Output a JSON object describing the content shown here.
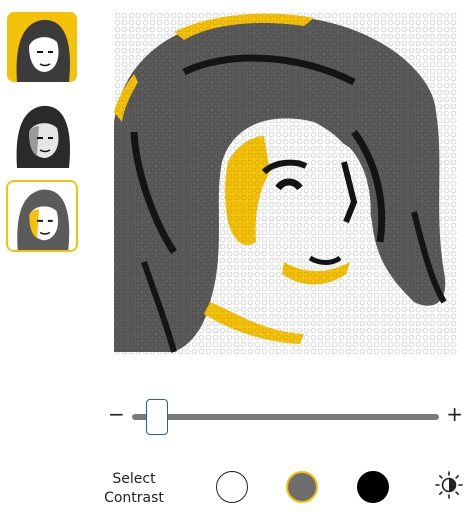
{
  "thumbnails": [
    {
      "palette": "yellow",
      "selected": false,
      "colors": {
        "bg": "#F5C20A",
        "hair": "#3b3b3b",
        "skin": "#ffffff"
      }
    },
    {
      "palette": "grayscale",
      "selected": false,
      "colors": {
        "bg": "#ffffff",
        "hair": "#2a2a2a",
        "skin": "#d9d9d9"
      }
    },
    {
      "palette": "gray-yellow",
      "selected": true,
      "colors": {
        "bg": "#ffffff",
        "hair": "#5b5b5b",
        "skin": "#F5C20A"
      }
    }
  ],
  "mosaic": {
    "colors": {
      "dot": "#dddddd",
      "hair": "#5c5c5c",
      "dark": "#141414",
      "yellow": "#F5C20A",
      "white": "#ffffff",
      "mid": "#8a8a8a"
    }
  },
  "slider": {
    "minus": "−",
    "plus": "+",
    "value": 0.08
  },
  "contrast": {
    "label_line1": "Select",
    "label_line2": "Contrast",
    "options": [
      "white",
      "gray",
      "black"
    ],
    "selected": "gray",
    "accent": "#F5C20A"
  },
  "icons": {
    "brightness": "brightness-icon"
  }
}
